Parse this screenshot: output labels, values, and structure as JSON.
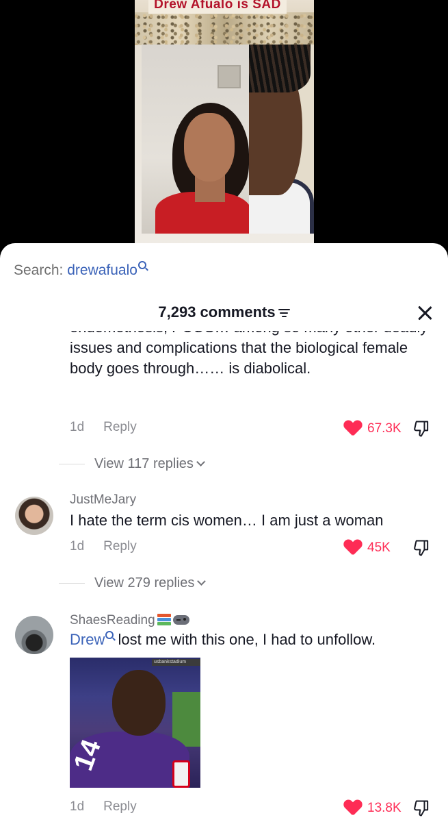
{
  "video": {
    "title_text": "Drew Afualo is SAD"
  },
  "sheet": {
    "search_prefix": "Search:",
    "search_term": "drewafualo",
    "comments_count": "7,293 comments"
  },
  "comments": [
    {
      "text_partial": "endometriosis, PCOS… among so many other deadly issues and complications that the biological female body goes through…… is diabolical.",
      "age": "1d",
      "reply_label": "Reply",
      "likes": "67.3K",
      "view_replies": "View 117 replies"
    },
    {
      "username": "JustMeJary",
      "text": "I hate the term cis women… I am just a woman",
      "age": "1d",
      "reply_label": "Reply",
      "likes": "45K",
      "view_replies": "View 279 replies"
    },
    {
      "username": "ShaesReading",
      "mention": "Drew",
      "text": " lost me with this one, I had to unfollow.",
      "attachment_banner": "usbankstadium",
      "attachment_number": "14",
      "age": "1d",
      "reply_label": "Reply",
      "likes": "13.8K"
    }
  ],
  "colors": {
    "like_red": "#fe2c55",
    "mention_blue": "#3a62b8",
    "text_dark": "#161823",
    "text_gray": "#8a8b91"
  }
}
